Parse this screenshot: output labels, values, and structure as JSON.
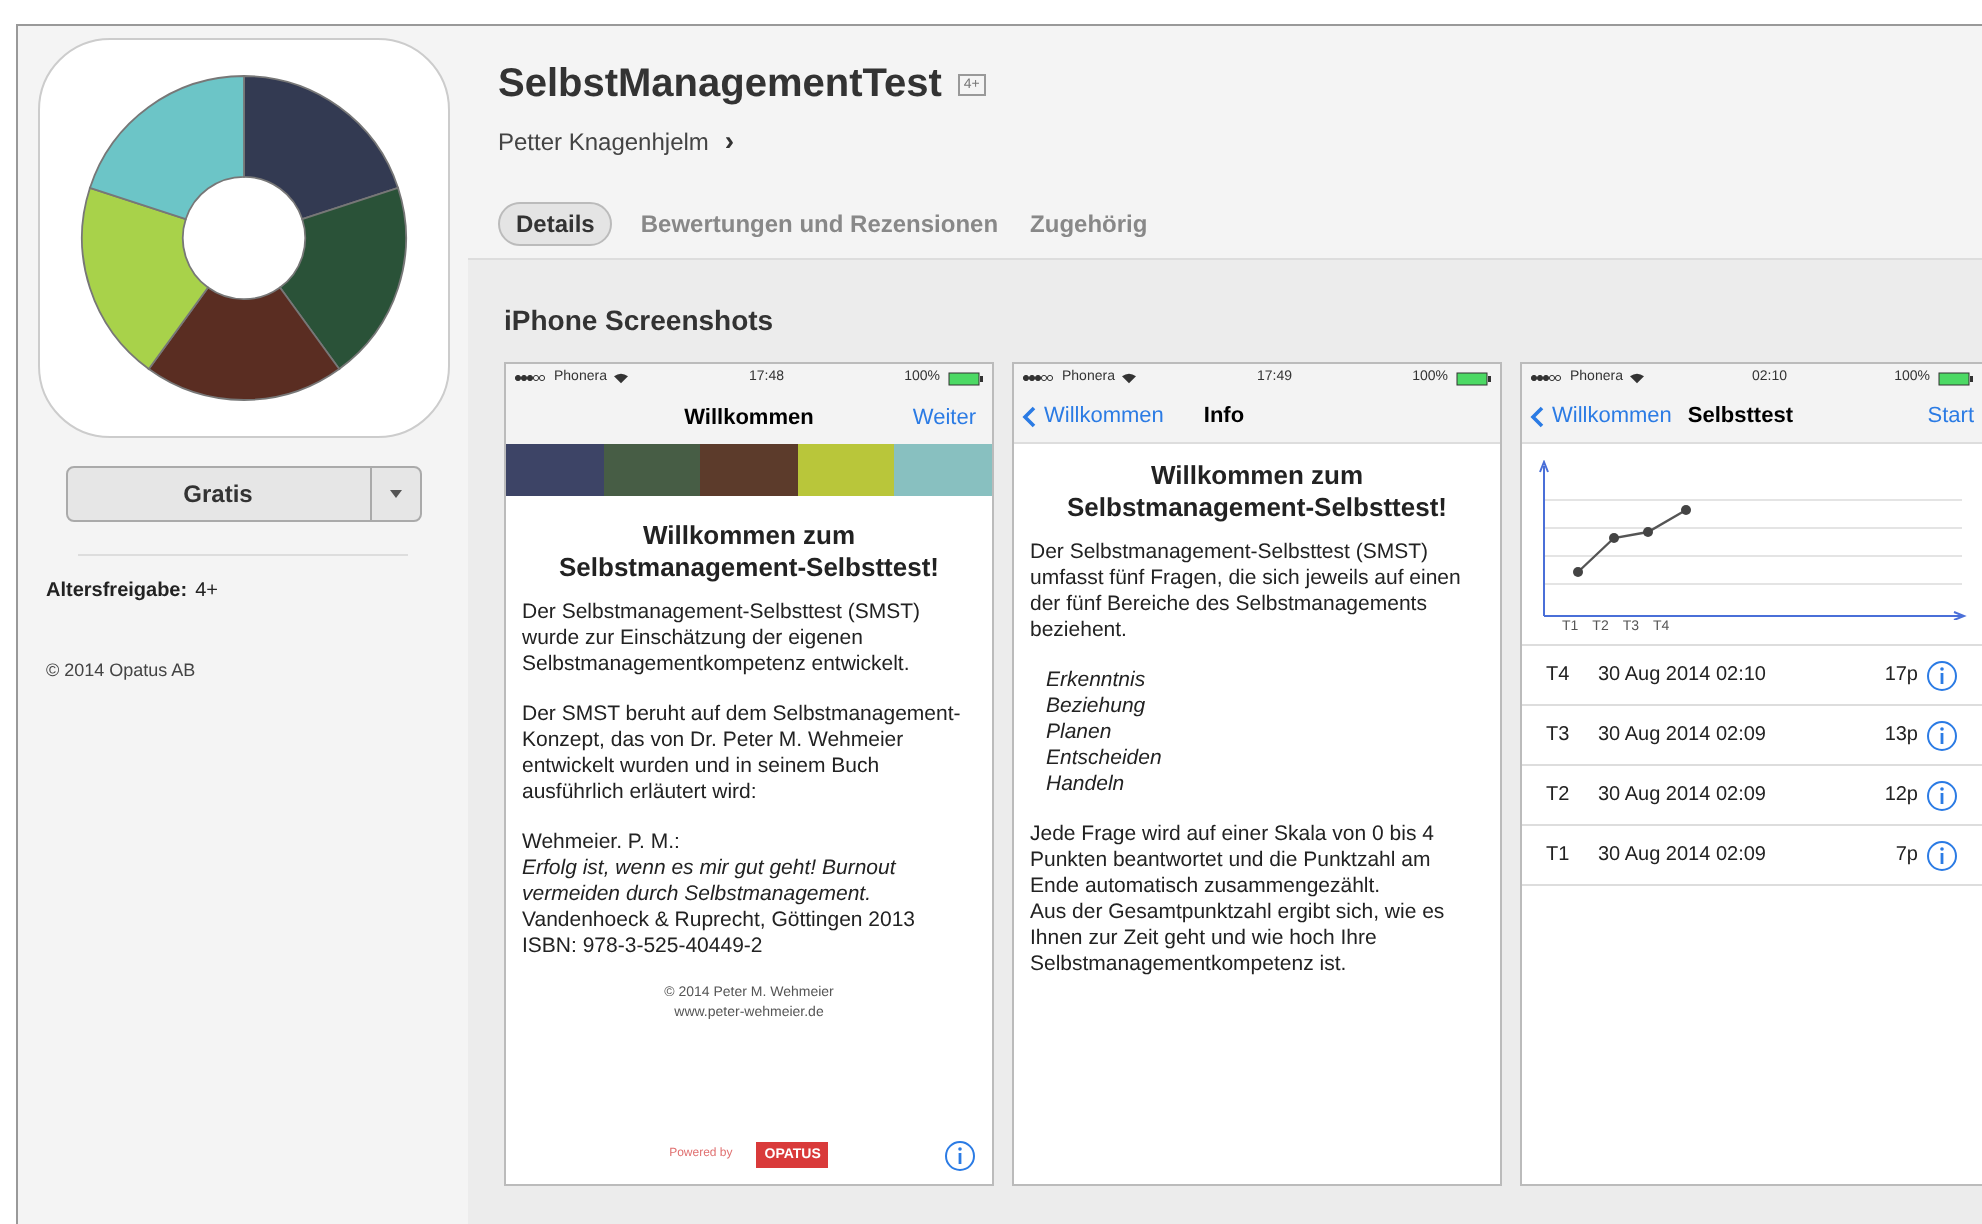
{
  "app": {
    "title": "SelbstManagementTest",
    "age_badge": "4+",
    "developer": "Petter Knagenhjelm",
    "developer_arrow": "›",
    "tabs": [
      {
        "label": "Details",
        "selected": true
      },
      {
        "label": "Bewertungen und Rezensionen",
        "selected": false
      },
      {
        "label": "Zugehörig",
        "selected": false
      }
    ],
    "section_title": "iPhone Screenshots"
  },
  "sidebar": {
    "button": "Gratis",
    "age_label": "Altersfreigabe:",
    "age_value": "4+",
    "copyright": "© 2014 Opatus AB"
  },
  "screenshots": [
    {
      "kind": "welcome",
      "status": {
        "carrier": "Phonera",
        "time": "17:48",
        "battery": "100%"
      },
      "nav": {
        "title": "Willkommen",
        "action": "Weiter"
      },
      "strip": [
        {
          "color": "#3d4466"
        },
        {
          "color": "#475d45"
        },
        {
          "color": "#5c3b2b"
        },
        {
          "color": "#b9c63a"
        },
        {
          "color": "#88c0c0"
        }
      ],
      "heading": "Willkommen zum Selbstmanagement-Selbsttest!",
      "paragraphs": [
        "Der Selbstmanagement-Selbsttest (SMST) wurde zur Einschätzung der eigenen Selbstmanagementkompetenz entwickelt.",
        "Der SMST beruht auf dem Selbstmanagement-Konzept, das von Dr. Peter M. Wehmeier entwickelt wurden und in seinem Buch ausführlich erläutert wird:",
        "Wehmeier. P. M.:\n*Erfolg ist, wenn es mir gut geht! Burnout vermeiden durch Selbstmanagement.*\nVandenhoeck & Ruprecht, Göttingen 2013\nISBN: 978-3-525-40449-2"
      ],
      "footer": [
        "© 2014 Peter M. Wehmeier",
        "www.peter-wehmeier.de"
      ],
      "powered": "Powered by",
      "logo": "OPATUS"
    },
    {
      "kind": "info",
      "status": {
        "carrier": "Phonera",
        "time": "17:49",
        "battery": "100%"
      },
      "nav": {
        "back": "Willkommen",
        "title": "Info"
      },
      "heading": "Willkommen zum Selbstmanagement-Selbsttest!",
      "paragraphs": [
        "Der Selbstmanagement-Selbsttest (SMST) umfasst fünf Fragen, die sich jeweils auf einen der fünf Bereiche des Selbstmanagements beziehent."
      ],
      "list": [
        "Erkenntnis",
        "Beziehung",
        "Planen",
        "Entscheiden",
        "Handeln"
      ],
      "closing": [
        "Jede Frage wird auf einer Skala von 0 bis 4 Punkten beantwortet und die Punktzahl am Ende automatisch zusammengezählt.",
        "Aus der Gesamtpunktzahl ergibt sich, wie es Ihnen zur Zeit geht und wie hoch Ihre Selbstmanagementkompetenz  ist."
      ]
    },
    {
      "kind": "tests",
      "status": {
        "carrier": "Phonera",
        "time": "02:10",
        "battery": "100%"
      },
      "nav": {
        "back": "Willkommen",
        "title": "Selbsttest",
        "action": "Start"
      },
      "chart_labels": [
        "T1",
        "T2",
        "T3",
        "T4"
      ],
      "rows": [
        {
          "test": "T4",
          "date": "30 Aug 2014 02:10",
          "points": "17p"
        },
        {
          "test": "T3",
          "date": "30 Aug 2014 02:09",
          "points": "13p"
        },
        {
          "test": "T2",
          "date": "30 Aug 2014 02:09",
          "points": "12p"
        },
        {
          "test": "T1",
          "date": "30 Aug 2014 02:09",
          "points": "7p"
        }
      ]
    }
  ]
}
